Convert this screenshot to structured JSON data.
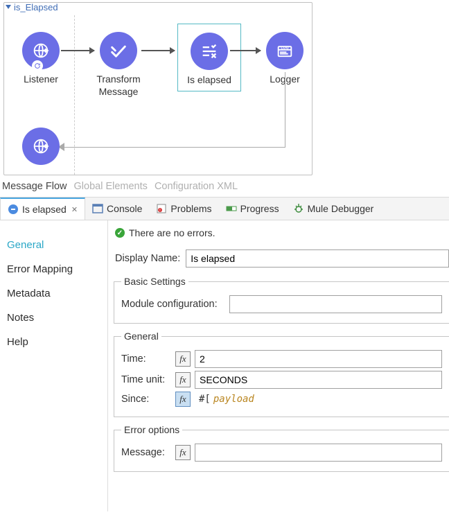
{
  "flow": {
    "name": "is_Elapsed",
    "nodes": {
      "listener_label": "Listener",
      "transform_label": "Transform Message",
      "iselapsed_label": "Is elapsed",
      "logger_label": "Logger"
    }
  },
  "editorTabs": {
    "messageFlow": "Message Flow",
    "globalElements": "Global Elements",
    "configXml": "Configuration XML"
  },
  "views": {
    "isElapsed": "Is elapsed",
    "console": "Console",
    "problems": "Problems",
    "progress": "Progress",
    "muleDebugger": "Mule Debugger"
  },
  "status": {
    "text": "There are no errors."
  },
  "side": {
    "general": "General",
    "errorMapping": "Error Mapping",
    "metadata": "Metadata",
    "notes": "Notes",
    "help": "Help"
  },
  "form": {
    "displayName_label": "Display Name:",
    "displayName_value": "Is elapsed",
    "basicSettings_legend": "Basic Settings",
    "moduleConfig_label": "Module configuration:",
    "moduleConfig_value": "",
    "general_legend": "General",
    "time_label": "Time:",
    "time_value": "2",
    "timeUnit_label": "Time unit:",
    "timeUnit_value": "SECONDS",
    "since_label": "Since:",
    "since_prefix": "#[",
    "since_value": "payload",
    "errorOptions_legend": "Error options",
    "message_label": "Message:",
    "message_value": ""
  },
  "fx_label": "fx"
}
